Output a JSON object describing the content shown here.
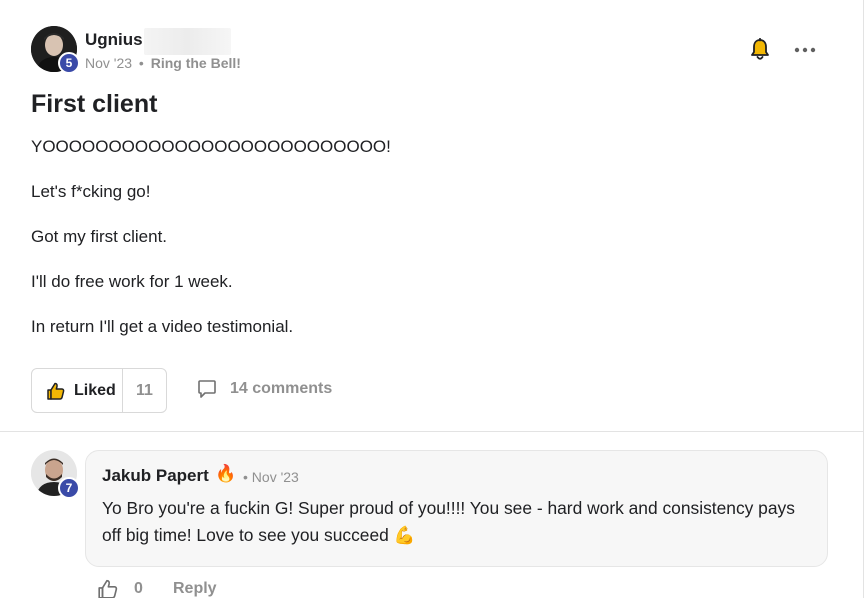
{
  "post": {
    "author": {
      "name": "Ugnius",
      "level": "5",
      "avatar_icon": "user-avatar"
    },
    "date": "Nov '23",
    "separator": "•",
    "category": "Ring the Bell!",
    "title": "First client",
    "paragraphs": [
      "YOOOOOOOOOOOOOOOOOOOOOOOOOO!",
      "Let's f*cking go!",
      "Got my first client.",
      "I'll do free work for 1 week.",
      "In return I'll get a video testimonial."
    ],
    "like_label": "Liked",
    "like_count": "11",
    "comments_label": "14 comments",
    "icons": {
      "bell": "bell-icon",
      "more": "more-options-icon",
      "like": "thumbs-up-icon",
      "comment": "comment-bubble-icon"
    }
  },
  "comment": {
    "author": "Jakub Papert",
    "badge_emoji": "🔥",
    "level": "7",
    "date": "• Nov '23",
    "text": "Yo Bro you're a fuckin G! Super proud of you!!!! You see - hard work and consistency pays off big time! Love to see you succeed 💪",
    "like_count": "0",
    "reply_label": "Reply"
  },
  "colors": {
    "text": "#202124",
    "muted": "#909090",
    "level_badge": "#3a4aa8",
    "bell": "#e2a100",
    "border": "#d9d9d9"
  }
}
